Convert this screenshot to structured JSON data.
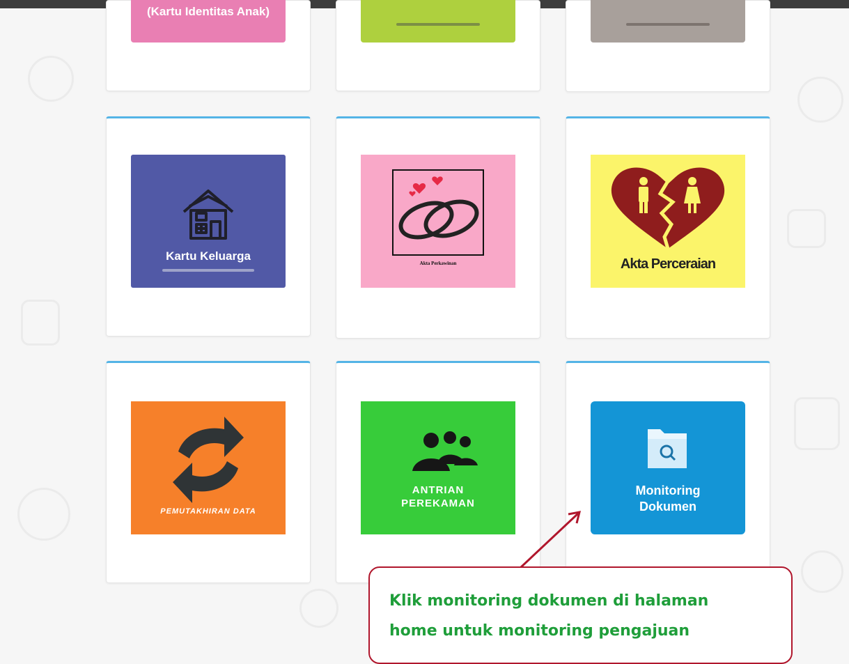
{
  "top_row": {
    "kia": {
      "label": "(Kartu Identitas Anak)",
      "color": "#e97fb3"
    },
    "pindah_datang": {
      "color": "#aed03e"
    },
    "pindah_keluar": {
      "color": "#a8a09b"
    }
  },
  "tiles": {
    "kartu_keluarga": {
      "label": "Kartu Keluarga",
      "color": "#5159a6",
      "icon": "house-icon"
    },
    "akta_perkawinan": {
      "label": "Akta Perkawinan",
      "color": "#f9a8c8",
      "icon": "wedding-rings-icon"
    },
    "akta_perceraian": {
      "label": "Akta Perceraian",
      "color": "#fbf46a",
      "icon": "broken-heart-icon"
    },
    "pemutakhiran_data": {
      "label": "PEMUTAKHIRAN DATA",
      "color": "#f6802a",
      "icon": "refresh-arrows-icon"
    },
    "antrian_perekaman": {
      "label_line1": "ANTRIAN",
      "label_line2": "PEREKAMAN",
      "color": "#37cc3a",
      "icon": "people-group-icon"
    },
    "monitoring_dokumen": {
      "label_line1": "Monitoring",
      "label_line2": "Dokumen",
      "color": "#1495d6",
      "icon": "folder-search-icon"
    }
  },
  "callout": {
    "line1": "Klik monitoring dokumen di halaman",
    "line2": "home untuk monitoring pengajuan",
    "border_color": "#b0162c",
    "text_color": "#1f9e3a"
  }
}
